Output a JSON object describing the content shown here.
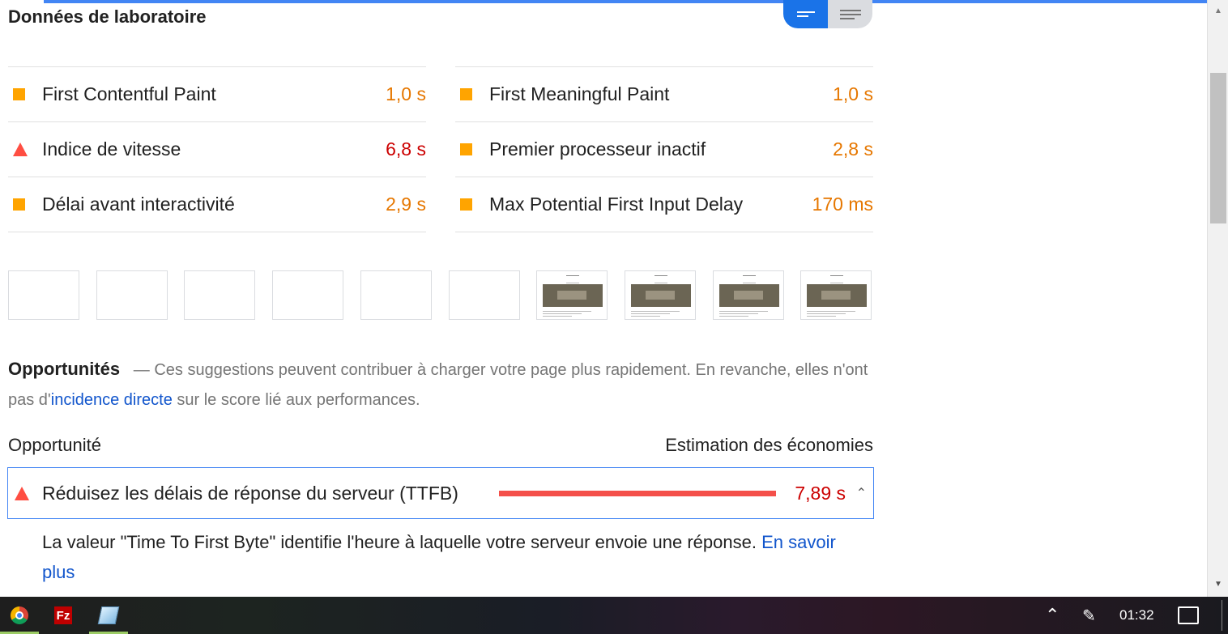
{
  "lab": {
    "title": "Données de laboratoire",
    "metrics_left": [
      {
        "label": "First Contentful Paint",
        "value": "1,0 s",
        "status": "average",
        "icon": "orange-square-icon"
      },
      {
        "label": "Indice de vitesse",
        "value": "6,8 s",
        "status": "fail",
        "icon": "red-triangle-icon"
      },
      {
        "label": "Délai avant interactivité",
        "value": "2,9 s",
        "status": "average",
        "icon": "orange-square-icon"
      }
    ],
    "metrics_right": [
      {
        "label": "First Meaningful Paint",
        "value": "1,0 s",
        "status": "average",
        "icon": "orange-square-icon"
      },
      {
        "label": "Premier processeur inactif",
        "value": "2,8 s",
        "status": "average",
        "icon": "orange-square-icon"
      },
      {
        "label": "Max Potential First Input Delay",
        "value": "170 ms",
        "status": "average",
        "icon": "orange-square-icon"
      }
    ]
  },
  "filmstrip": {
    "frame_count": 10,
    "empty_frames": 6
  },
  "opportunities": {
    "title": "Opportunités",
    "dash": "—",
    "description_part1": "Ces suggestions peuvent contribuer à charger votre page plus rapidement. En revanche, elles n'ont pas d'",
    "description_link": "incidence directe",
    "description_part2": " sur le score lié aux performances.",
    "col_left": "Opportunité",
    "col_right": "Estimation des économies",
    "items": [
      {
        "label": "Réduisez les délais de réponse du serveur (TTFB)",
        "value": "7,89 s",
        "bar_fraction": 1.0,
        "description": "La valeur \"Time To First Byte\" identifie l'heure à laquelle votre serveur envoie une réponse. ",
        "link": "En savoir plus"
      }
    ]
  },
  "taskbar": {
    "apps": [
      "chrome-icon",
      "filezilla-icon",
      "notebook-icon"
    ],
    "filezilla_label": "Fz",
    "time": "01:32"
  },
  "colors": {
    "average": "#ffa400",
    "fail": "#ff4e42",
    "accent": "#1a73e8"
  }
}
